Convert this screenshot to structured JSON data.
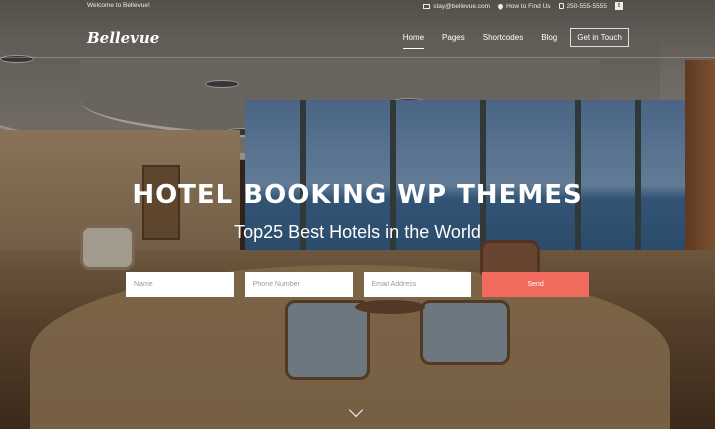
{
  "topbar": {
    "welcome": "Welcome to Bellevue!",
    "email": "stay@bellevue.com",
    "location_link": "How to Find Us",
    "phone": "250-555-5555",
    "social_icon": "twitter-icon"
  },
  "nav": {
    "logo": "Bellevue",
    "items": [
      "Home",
      "Pages",
      "Shortcodes",
      "Blog"
    ],
    "cta": "Get in Touch"
  },
  "hero": {
    "title": "HOTEL BOOKING WP THEMES",
    "subtitle": "Top25 Best Hotels in the World"
  },
  "form": {
    "name_placeholder": "Name",
    "phone_placeholder": "Phone Number",
    "email_placeholder": "Email Address",
    "submit_label": "Send"
  },
  "colors": {
    "accent": "#f16a5e",
    "text": "#ffffff"
  }
}
